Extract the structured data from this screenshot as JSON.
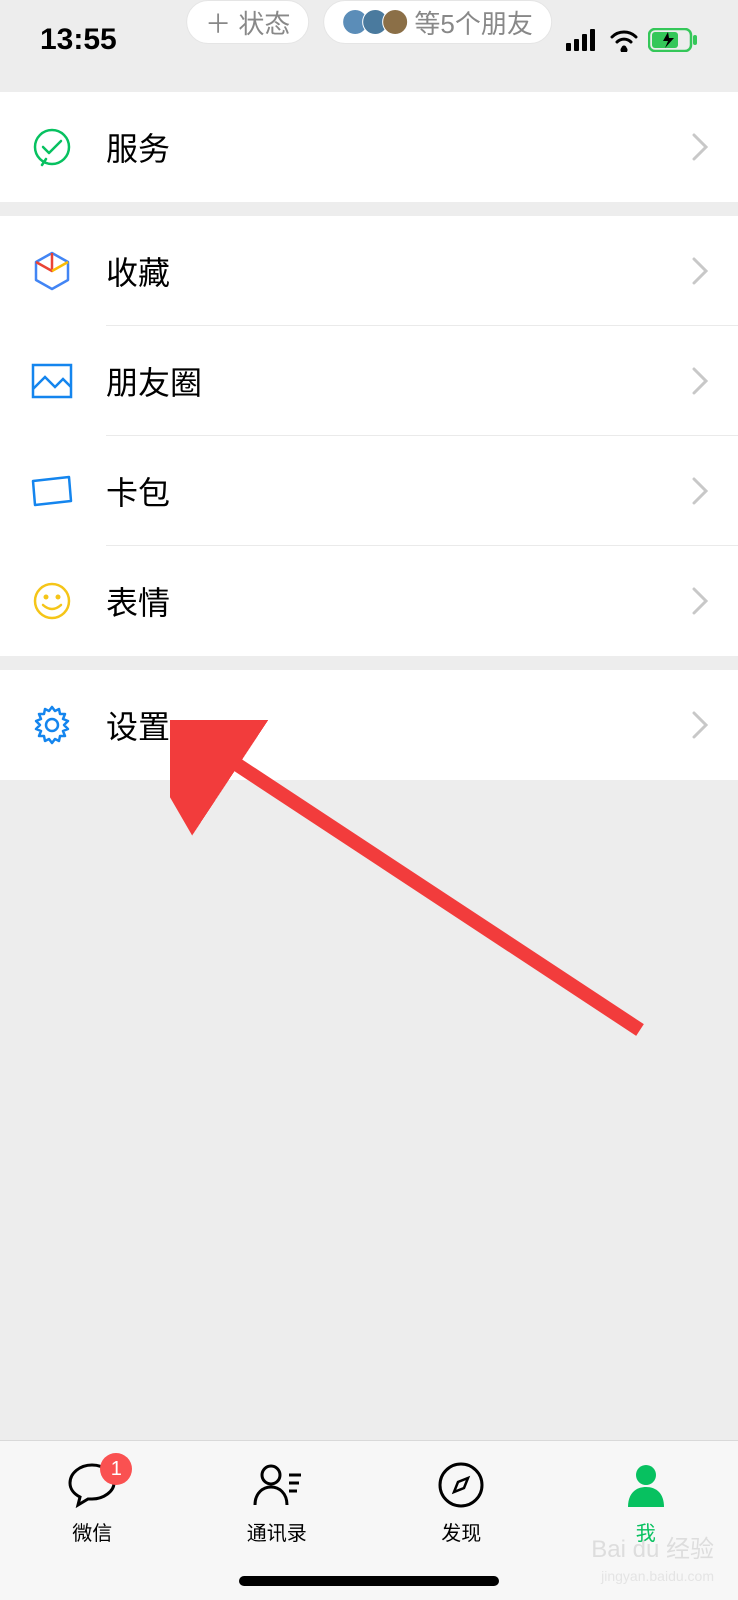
{
  "status": {
    "time": "13:55"
  },
  "header": {
    "status_pill": "＋ 状态",
    "friends_pill": "等5个朋友"
  },
  "menu": {
    "services": "服务",
    "favorites": "收藏",
    "moments": "朋友圈",
    "cards": "卡包",
    "stickers": "表情",
    "settings": "设置"
  },
  "tabs": {
    "chat": {
      "label": "微信",
      "badge": "1"
    },
    "contacts": {
      "label": "通讯录"
    },
    "discover": {
      "label": "发现"
    },
    "me": {
      "label": "我"
    }
  },
  "watermark": {
    "brand": "Bai du 经验",
    "sub": "jingyan.baidu.com"
  }
}
